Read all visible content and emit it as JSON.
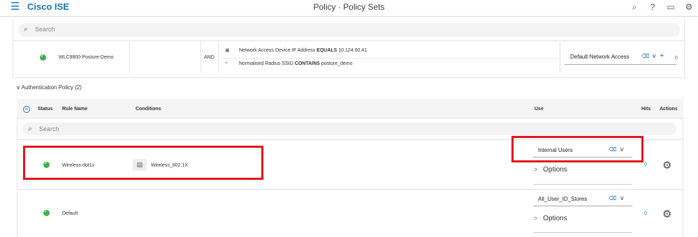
{
  "header": {
    "brand": "Cisco ISE",
    "title": "Policy · Policy Sets",
    "icons": [
      "search-icon",
      "help-icon",
      "notifications-icon",
      "settings-icon"
    ]
  },
  "policy_set": {
    "search_placeholder": "Search",
    "name": "WLC9800-Posture-Demo",
    "operator": "AND",
    "conditions": [
      {
        "attr": "Network Access·Device IP Address",
        "op": "EQUALS",
        "value": "10.124.60.41"
      },
      {
        "attr": "Normalised Radius·SSID",
        "op": "CONTAINS",
        "value": "posture_demo"
      }
    ],
    "allowed_protocol": "Default Network Access",
    "hits": "0"
  },
  "auth_policy": {
    "section_label": "Authentication Policy (2)",
    "columns": {
      "status": "Status",
      "rule_name": "Rule Name",
      "conditions": "Conditions",
      "use": "Use",
      "hits": "Hits",
      "actions": "Actions"
    },
    "search_placeholder": "Search",
    "rules": [
      {
        "name": "Wireless-dot1x",
        "condition": "Wireless_802.1X",
        "use": "Internal Users",
        "options": "Options",
        "hits": "0"
      },
      {
        "name": "Default",
        "condition": "",
        "use": "All_User_ID_Stores",
        "options": "Options",
        "hits": "0"
      }
    ]
  },
  "colors": {
    "accent": "#1b75bb",
    "status_green": "#3bb34a",
    "highlight_red": "#e0161c"
  }
}
